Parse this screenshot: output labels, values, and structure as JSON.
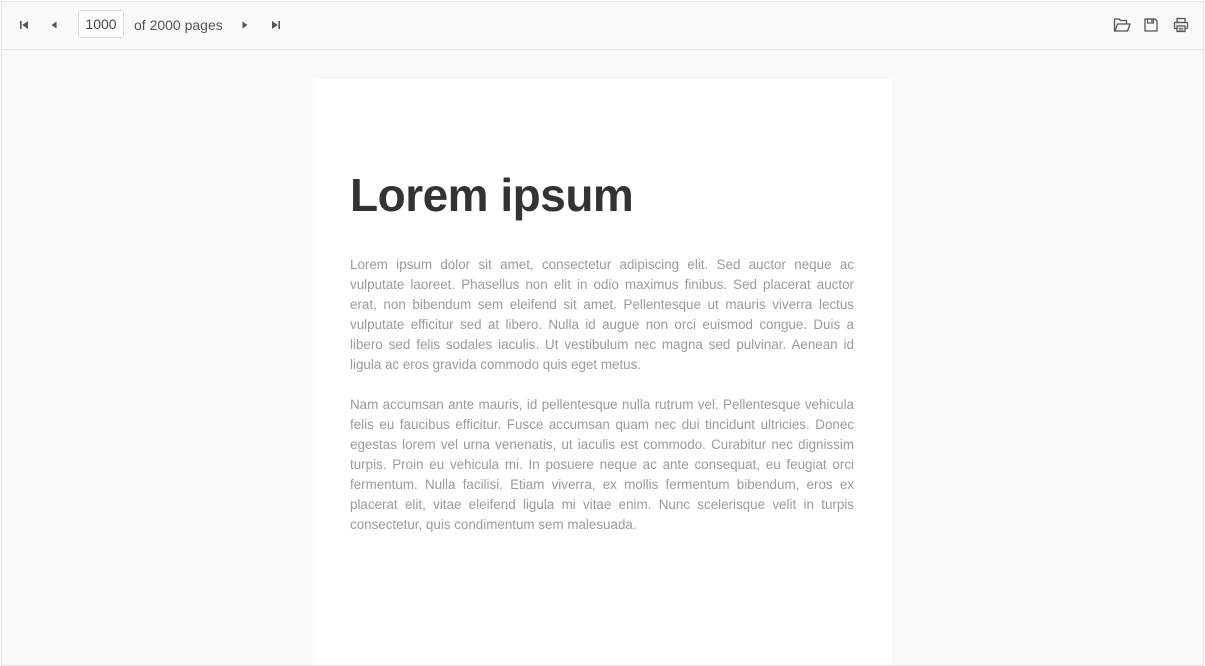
{
  "toolbar": {
    "first_page_icon": "first-page-icon",
    "prev_page_icon": "prev-page-icon",
    "next_page_icon": "next-page-icon",
    "last_page_icon": "last-page-icon",
    "open_icon": "folder-open-icon",
    "save_icon": "save-icon",
    "print_icon": "print-icon",
    "current_page": "1000",
    "page_count_text": "of 2000 pages"
  },
  "document": {
    "title": "Lorem ipsum",
    "paragraphs": [
      "Lorem ipsum dolor sit amet, consectetur adipiscing elit. Sed auctor neque ac vulputate laoreet. Phasellus non elit in odio maximus finibus. Sed placerat auctor erat, non bibendum sem eleifend sit amet. Pellentesque ut mauris viverra lectus vulputate efficitur sed at libero. Nulla id augue non orci euismod congue. Duis a libero sed felis sodales iaculis. Ut vestibulum nec magna sed pulvinar. Aenean id ligula ac eros gravida commodo quis eget metus.",
      "Nam accumsan ante mauris, id pellentesque nulla rutrum vel. Pellentesque vehicula felis eu faucibus efficitur. Fusce accumsan quam nec dui tincidunt ultricies. Donec egestas lorem vel urna venenatis, ut iaculis est commodo. Curabitur nec dignissim turpis. Proin eu vehicula mi. In posuere neque ac ante consequat, eu feugiat orci fermentum. Nulla facilisi. Etiam viverra, ex mollis fermentum bibendum, eros ex placerat elit, vitae eleifend ligula mi vitae enim. Nunc scelerisque velit in turpis consectetur, quis condimentum sem malesuada."
    ]
  },
  "colors": {
    "toolbar_bg": "#f9f9f9",
    "icon": "#555555",
    "title": "#333333",
    "body_text": "#9a9a9a",
    "page_bg": "#ffffff"
  }
}
